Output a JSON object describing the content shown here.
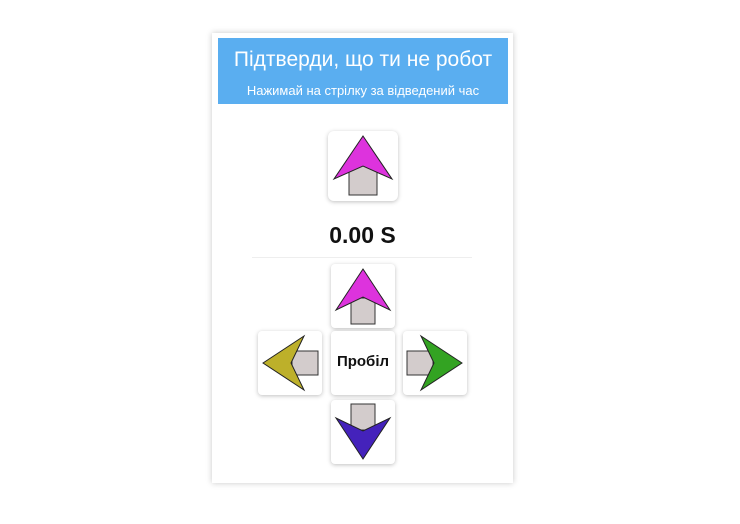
{
  "header": {
    "title": "Підтверди, що ти не робот",
    "subtitle": "Нажимай на стрілку за відведений час"
  },
  "target_arrow": {
    "direction": "up",
    "color": "#dd33dd"
  },
  "timer": {
    "value": "0.00 S"
  },
  "controls": {
    "up": {
      "direction": "up",
      "color": "#dd33dd"
    },
    "left": {
      "direction": "left",
      "color": "#bdb02a"
    },
    "space": {
      "label": "Пробіл"
    },
    "right": {
      "direction": "right",
      "color": "#33a322"
    },
    "down": {
      "direction": "down",
      "color": "#4422bb"
    }
  },
  "colors": {
    "header_bg": "#5aaef0",
    "arrow_stem": "#d3cccc"
  }
}
